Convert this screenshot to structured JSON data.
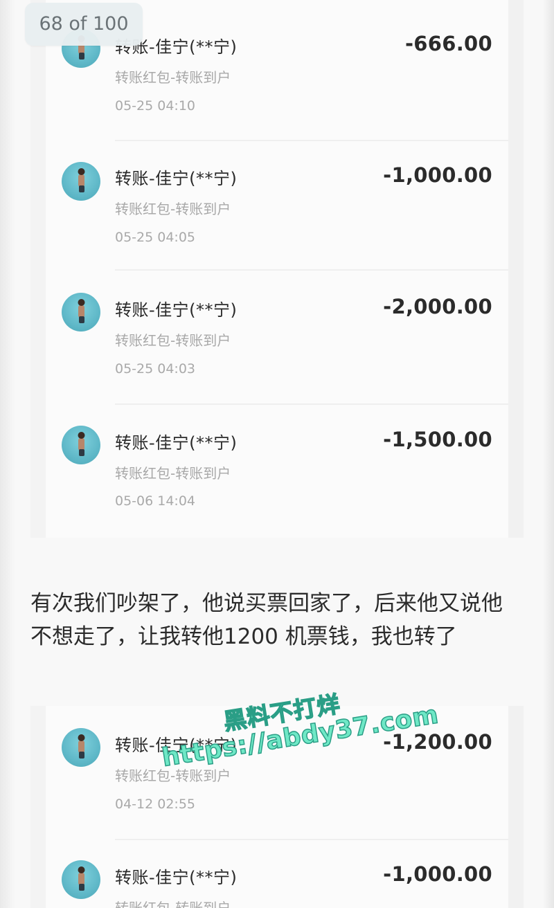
{
  "viewer": {
    "page_counter": "68 of 100"
  },
  "transactions_top": [
    {
      "title": "转账-佳宁(**宁)",
      "subtitle": "转账红包-转账到户",
      "time": "05-25 04:10",
      "amount": "-666.00",
      "avatar_icon": "profile-photo-icon"
    },
    {
      "title": "转账-佳宁(**宁)",
      "subtitle": "转账红包-转账到户",
      "time": "05-25 04:05",
      "amount": "-1,000.00",
      "avatar_icon": "profile-photo-icon"
    },
    {
      "title": "转账-佳宁(**宁)",
      "subtitle": "转账红包-转账到户",
      "time": "05-25 04:03",
      "amount": "-2,000.00",
      "avatar_icon": "profile-photo-icon"
    },
    {
      "title": "转账-佳宁(**宁)",
      "subtitle": "转账红包-转账到户",
      "time": "05-06 14:04",
      "amount": "-1,500.00",
      "avatar_icon": "profile-photo-icon"
    }
  ],
  "caption": {
    "line1": "有次我们吵架了，他说买票回家了，后来他又说他",
    "line2": "不想走了，让我转他1200 机票钱，我也转了"
  },
  "transactions_bottom": [
    {
      "title": "转账-佳宁(**宁)",
      "subtitle": "转账红包-转账到户",
      "time": "04-12 02:55",
      "amount": "-1,200.00",
      "avatar_icon": "profile-photo-icon"
    },
    {
      "title": "转账-佳宁(**宁)",
      "subtitle": "转账红包-转账到户",
      "time": "",
      "amount": "-1,000.00",
      "avatar_icon": "profile-photo-icon"
    }
  ],
  "watermark": {
    "line1": "黑料不打烊",
    "line2": "https://abdy37.com"
  },
  "colors": {
    "amount": "#2b2b2b",
    "subtitle": "#a8a8a8",
    "avatar_bg": "#5fb8c8",
    "watermark_fill": "#6fe8c6",
    "watermark_stroke": "#2a9e86"
  }
}
